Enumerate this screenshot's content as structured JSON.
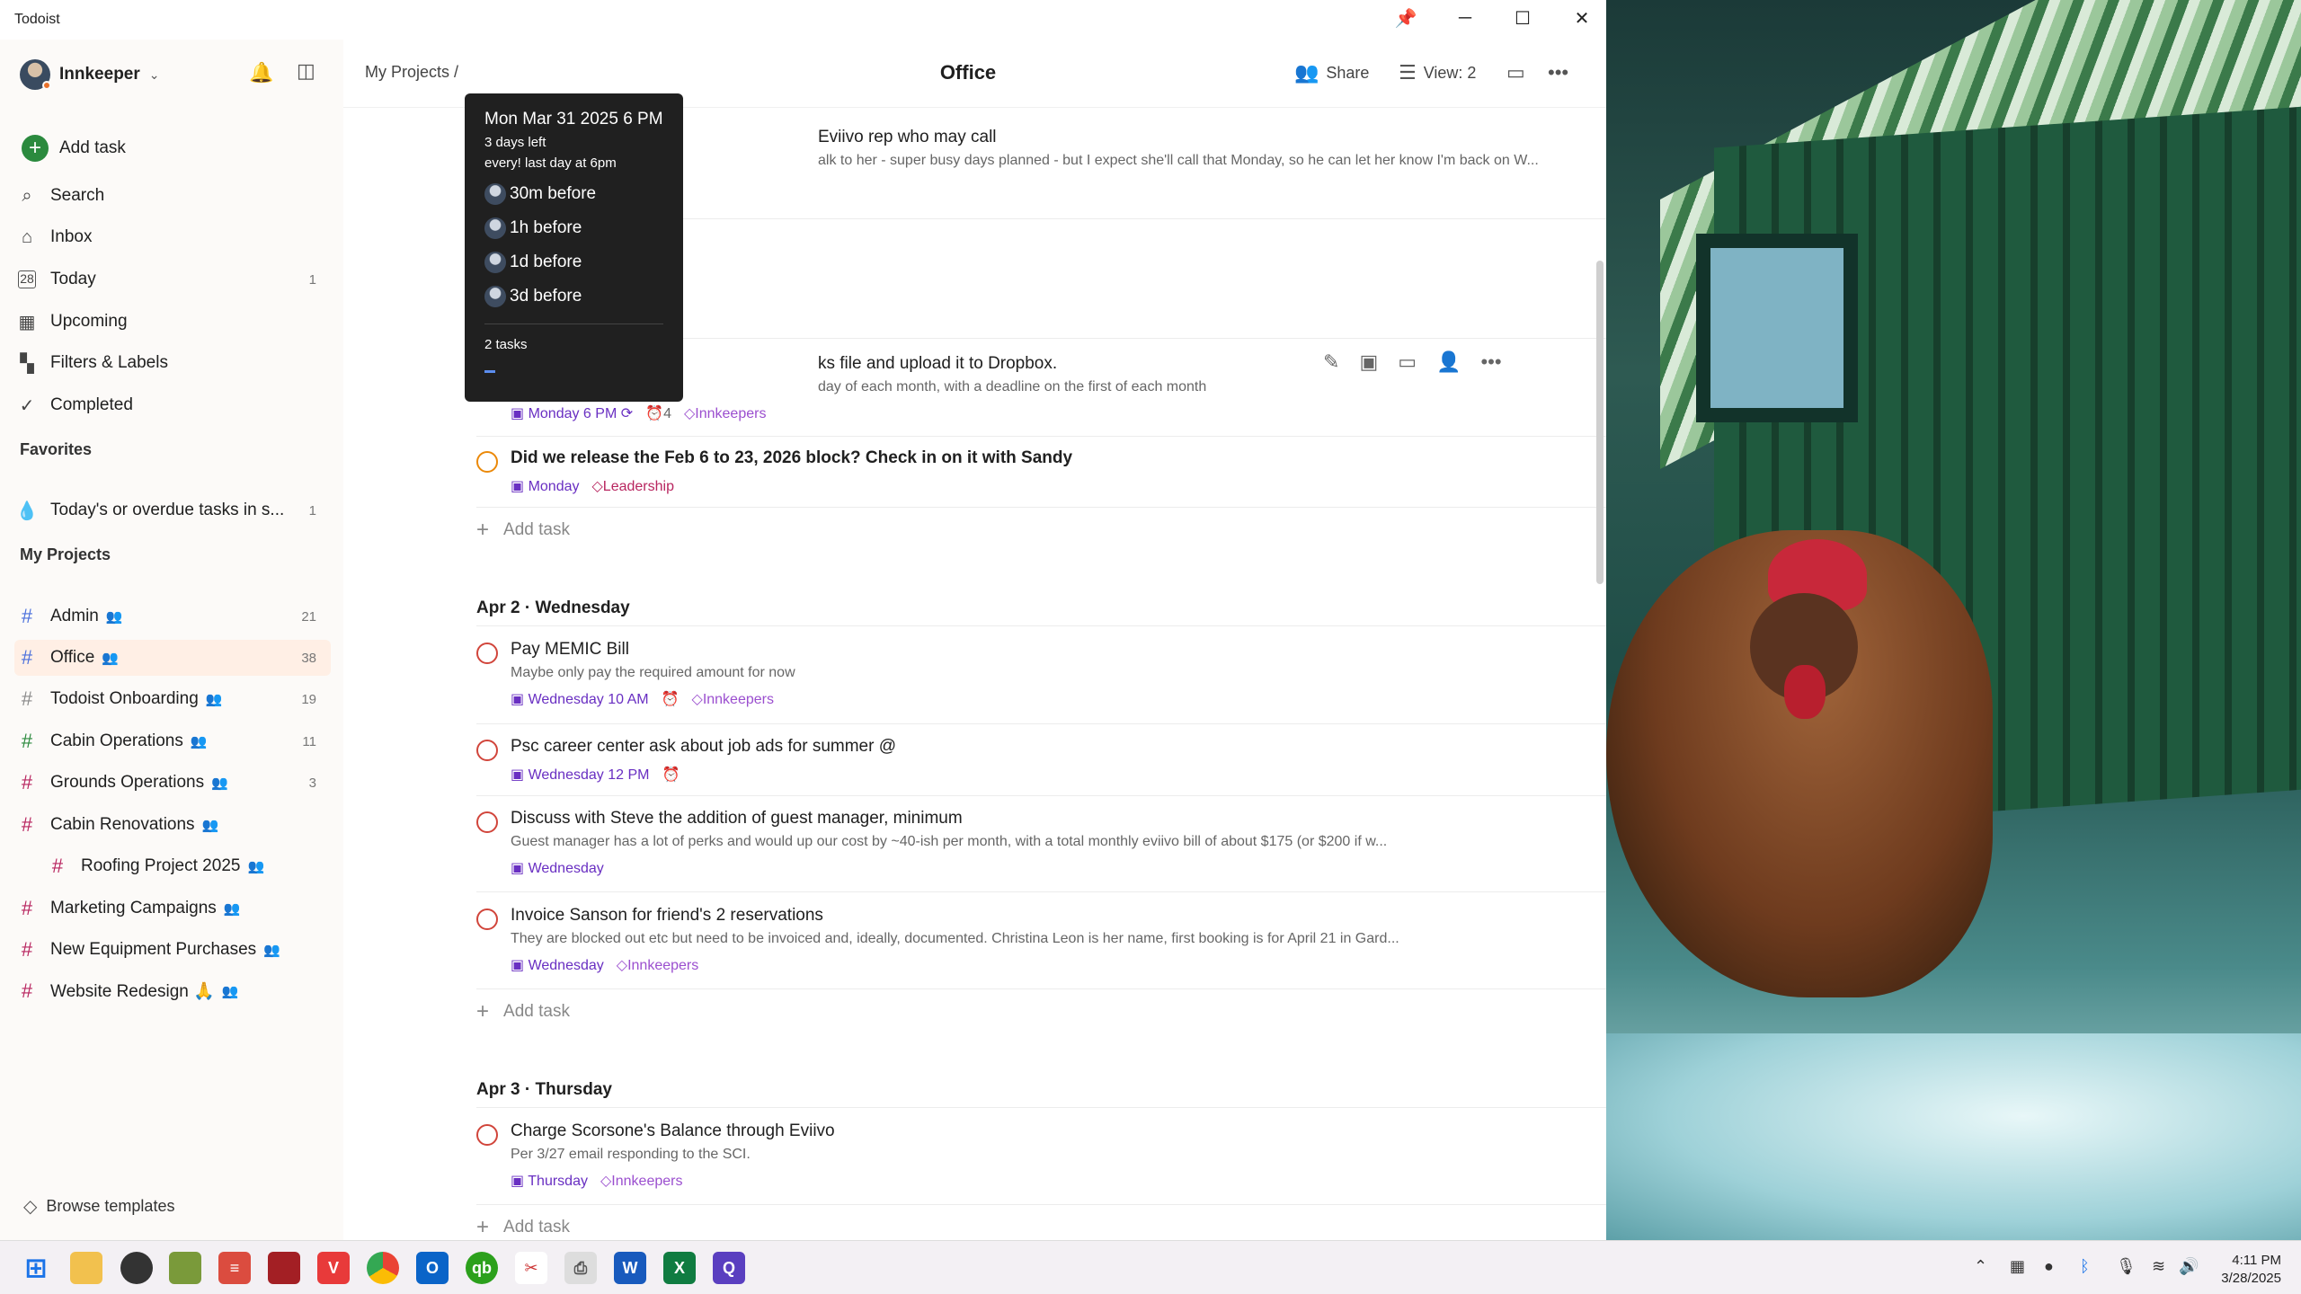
{
  "window": {
    "app_name": "Todoist"
  },
  "sidebar": {
    "user": "Innkeeper",
    "add_task": "Add task",
    "nav": [
      {
        "label": "Search",
        "icon": "search-icon"
      },
      {
        "label": "Inbox",
        "icon": "inbox-icon"
      },
      {
        "label": "Today",
        "icon": "calendar-day-icon",
        "count": "1"
      },
      {
        "label": "Upcoming",
        "icon": "calendar-icon"
      },
      {
        "label": "Filters & Labels",
        "icon": "grid-icon"
      },
      {
        "label": "Completed",
        "icon": "check-circle-icon"
      }
    ],
    "favorites_heading": "Favorites",
    "favorites": [
      {
        "label": "Today's or overdue tasks in s...",
        "count": "1"
      }
    ],
    "projects_heading": "My Projects",
    "projects": [
      {
        "label": "Admin",
        "count": "21"
      },
      {
        "label": "Office",
        "count": "38"
      },
      {
        "label": "Todoist Onboarding",
        "count": "19"
      },
      {
        "label": "Cabin Operations",
        "count": "11"
      },
      {
        "label": "Grounds Operations",
        "count": "3"
      },
      {
        "label": "Cabin Renovations",
        "count": ""
      },
      {
        "label": "Roofing Project 2025",
        "count": ""
      },
      {
        "label": "Marketing Campaigns",
        "count": ""
      },
      {
        "label": "New Equipment Purchases",
        "count": ""
      },
      {
        "label": "Website Redesign 🙏",
        "count": ""
      }
    ],
    "browse_templates": "Browse templates"
  },
  "header": {
    "breadcrumb": "My Projects /",
    "title": "Office",
    "share": "Share",
    "view": "View: 2"
  },
  "tooltip": {
    "date": "Mon Mar 31 2025 6 PM",
    "days_left": "3 days left",
    "recurrence": "every! last day at 6pm",
    "reminders": [
      "30m before",
      "1h before",
      "1d before",
      "3d before"
    ],
    "tasks": "2 tasks"
  },
  "tasks_top": [
    {
      "title": "Eviivo rep who may call",
      "desc": "alk to her - super busy days planned - but I expect she'll call that Monday, so he can let her know I'm back on W..."
    },
    {
      "title": "ks file and upload it to Dropbox.",
      "desc": "day of each month, with a deadline on the first of each month",
      "date": "Monday 6 PM",
      "reminders": "4",
      "label": "Innkeepers"
    },
    {
      "title": "Did we release the Feb 6 to 23, 2026 block? Check in on it with Sandy",
      "date": "Monday",
      "label": "Leadership"
    }
  ],
  "add_task": "Add task",
  "days": [
    {
      "heading": "Apr 2 · Wednesday",
      "tasks": [
        {
          "title": "Pay MEMIC Bill",
          "desc": "Maybe only pay the required amount for now",
          "date": "Wednesday 10 AM",
          "label": "Innkeepers"
        },
        {
          "title": "Psc career center ask about job ads for summer @",
          "date": "Wednesday 12 PM"
        },
        {
          "title": "Discuss with Steve the addition of guest manager, minimum",
          "desc": "Guest manager has a lot of perks and would up our cost by ~40-ish per month, with a total monthly eviivo bill of about $175 (or $200 if w...",
          "date": "Wednesday"
        },
        {
          "title": "Invoice Sanson for friend's 2 reservations",
          "desc": "They are blocked out etc but need to be invoiced and, ideally, documented. Christina Leon is her name, first booking is for April 21 in Gard...",
          "date": "Wednesday",
          "label": "Innkeepers"
        }
      ]
    },
    {
      "heading": "Apr 3 · Thursday",
      "tasks": [
        {
          "title": "Charge Scorsone's Balance through Eviivo",
          "desc": "Per 3/27 email responding to the SCI.",
          "date": "Thursday",
          "label": "Innkeepers"
        }
      ]
    }
  ],
  "clock": {
    "time": "4:11 PM",
    "date": "3/28/2025"
  }
}
